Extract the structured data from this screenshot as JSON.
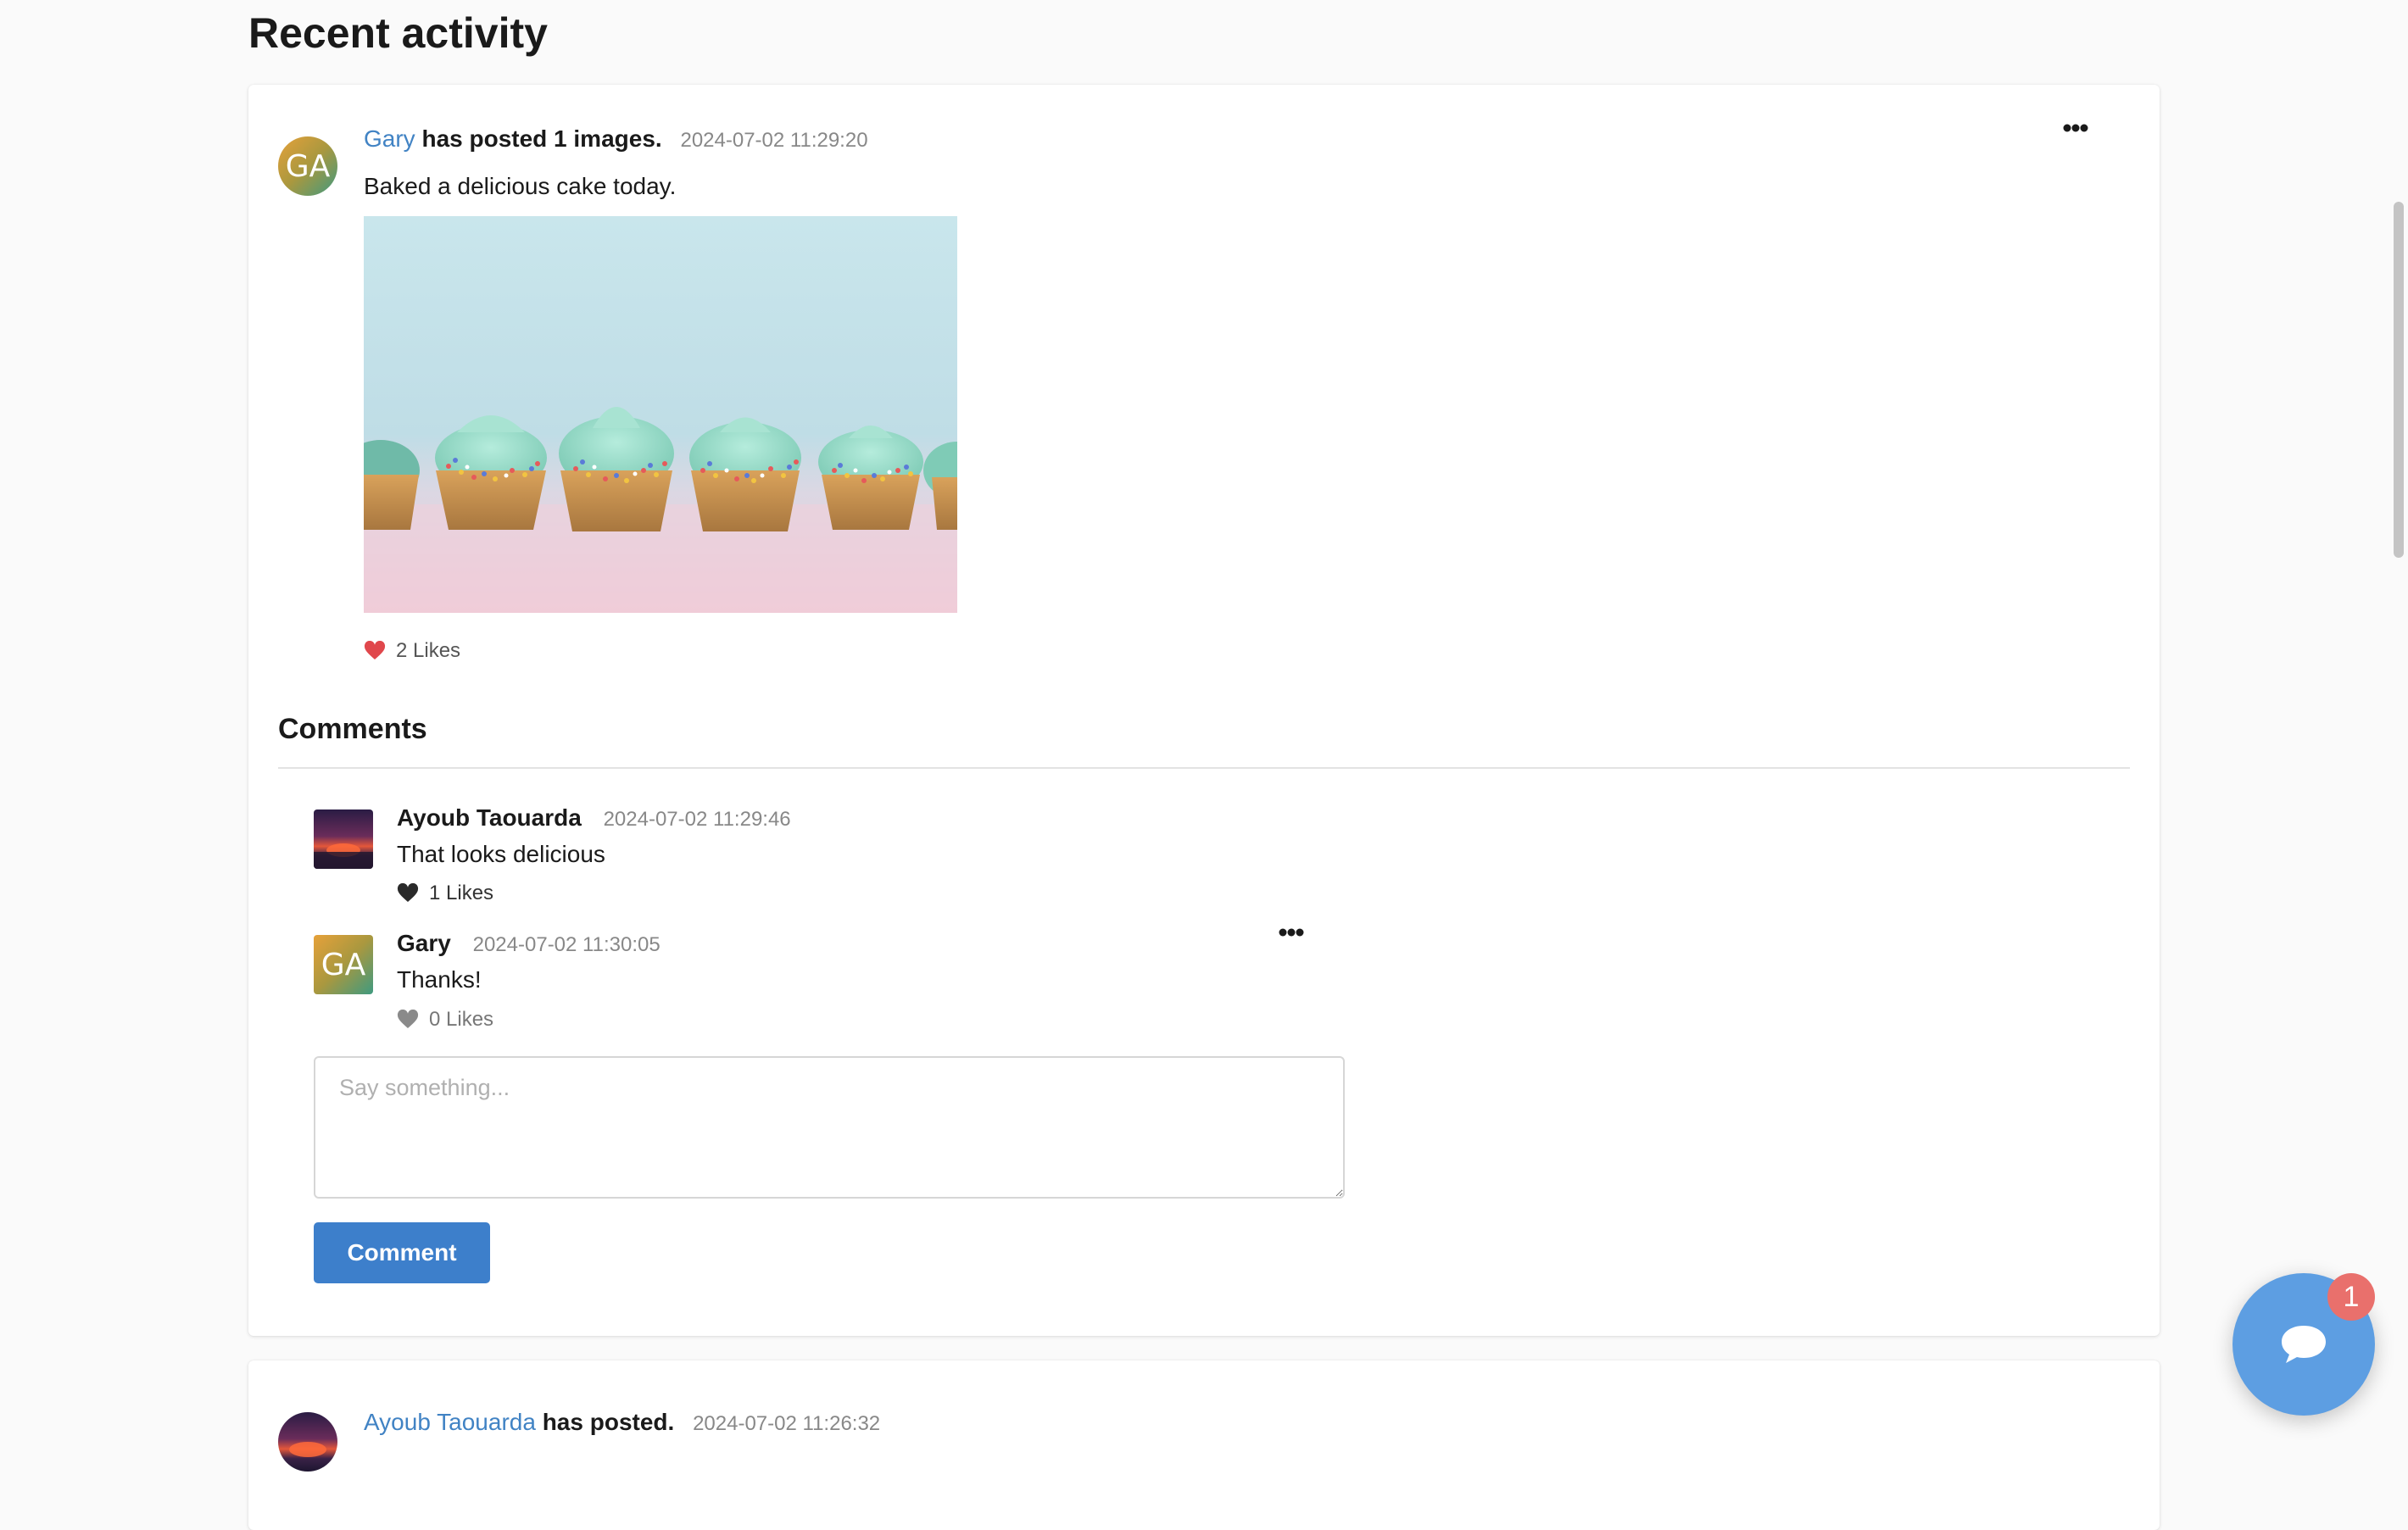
{
  "page": {
    "title": "Recent activity"
  },
  "post1": {
    "author": "Gary",
    "author_initials": "GA",
    "action": "has posted 1 images.",
    "timestamp": "2024-07-02 11:29:20",
    "text": "Baked a delicious cake today.",
    "image_icon": "cupcakes-photo",
    "likes": "2 Likes",
    "liked": true,
    "comments_title": "Comments",
    "comments": [
      {
        "author": "Ayoub Taouarda",
        "timestamp": "2024-07-02 11:29:46",
        "text": "That looks delicious",
        "likes": "1 Likes"
      },
      {
        "author": "Gary",
        "author_initials": "GA",
        "timestamp": "2024-07-02 11:30:05",
        "text": "Thanks!",
        "likes": "0 Likes"
      }
    ],
    "comment_input": {
      "value": "",
      "placeholder": "Say something..."
    },
    "comment_button": "Comment"
  },
  "post2": {
    "author": "Ayoub Taouarda",
    "action": "has posted.",
    "timestamp": "2024-07-02 11:26:32"
  },
  "chat": {
    "badge_count": "1"
  },
  "colors": {
    "link": "#4183c4",
    "primary_button": "#3d7fcb",
    "heart_liked": "#e0474c",
    "chat_fab": "#5d9ee2",
    "badge": "#e9706c"
  }
}
